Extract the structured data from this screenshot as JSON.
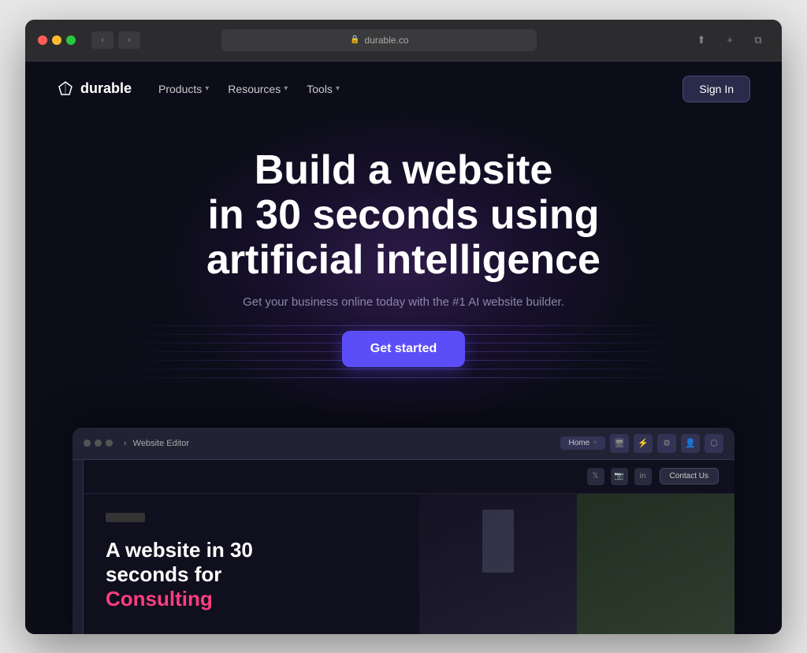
{
  "browser": {
    "url": "durable.co",
    "traffic_lights": [
      "red",
      "yellow",
      "green"
    ]
  },
  "nav": {
    "logo_text": "durable",
    "items": [
      {
        "label": "Products",
        "has_dropdown": true
      },
      {
        "label": "Resources",
        "has_dropdown": true
      },
      {
        "label": "Tools",
        "has_dropdown": true
      }
    ],
    "sign_in_label": "Sign In"
  },
  "hero": {
    "title_line1": "Build a website",
    "title_line2": "in 30 seconds using",
    "title_line3": "artificial intelligence",
    "subtitle": "Get your business online today with the #1 AI website builder.",
    "cta_label": "Get started"
  },
  "editor": {
    "title": "Website Editor",
    "tab_label": "Home",
    "contact_button": "Contact Us",
    "inner_title_line1": "A website in 30",
    "inner_title_line2": "seconds for",
    "inner_title_accent": "Consulting"
  }
}
